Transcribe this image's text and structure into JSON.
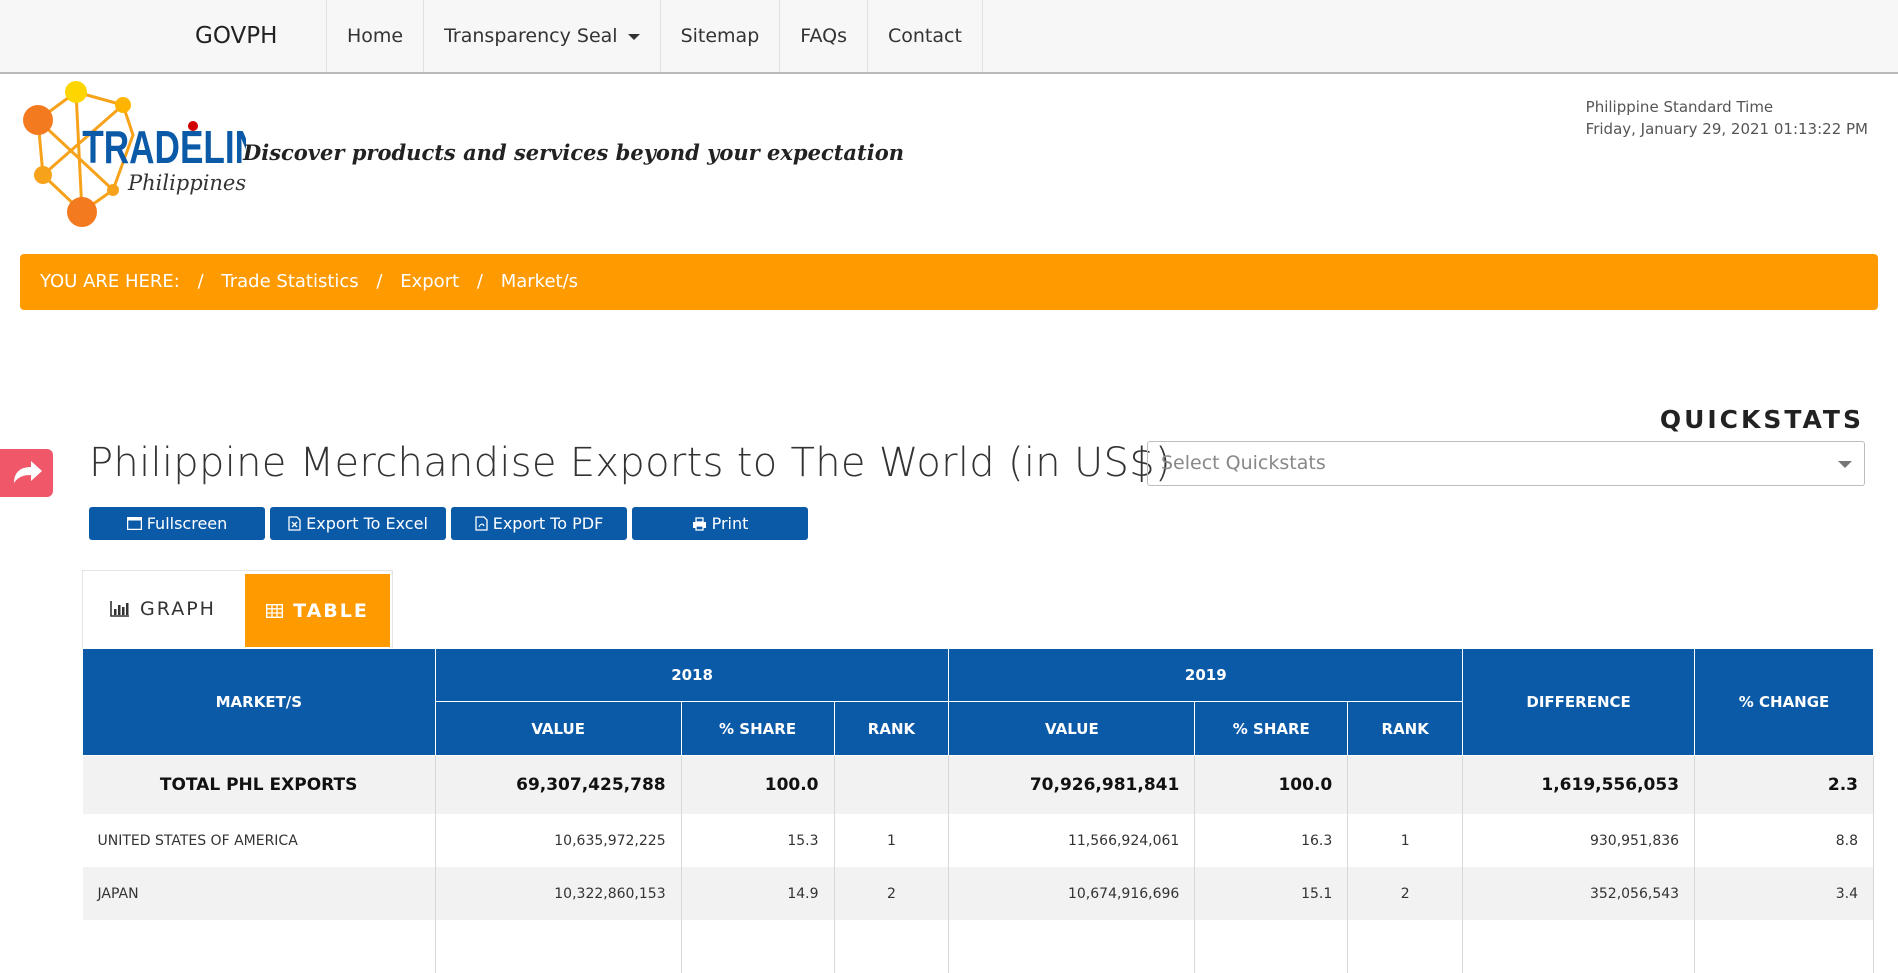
{
  "nav": {
    "brand": "GOVPH",
    "links": [
      "Home",
      "Transparency Seal",
      "Sitemap",
      "FAQs",
      "Contact"
    ]
  },
  "header": {
    "logo_text": "TRADELINE",
    "logo_sub": "Philippines",
    "tagline": "Discover products and services beyond your expectation",
    "clock_label": "Philippine Standard Time",
    "clock_value": "Friday, January 29, 2021 01:13:22 PM"
  },
  "breadcrumb": {
    "prefix": "YOU ARE HERE:",
    "items": [
      "Trade Statistics",
      "Export",
      "Market/s"
    ]
  },
  "page": {
    "title": "Philippine Merchandise Exports to The World (in US$)"
  },
  "quickstats": {
    "label": "QUICKSTATS",
    "placeholder": "Select Quickstats"
  },
  "actions": {
    "fullscreen": "Fullscreen",
    "excel": "Export To Excel",
    "pdf": "Export To PDF",
    "print": "Print"
  },
  "tabs": {
    "graph": "GRAPH",
    "table": "TABLE"
  },
  "table": {
    "headers": {
      "market": "MARKET/S",
      "year1": "2018",
      "year2": "2019",
      "difference": "DIFFERENCE",
      "change": "% CHANGE",
      "value": "VALUE",
      "share": "% SHARE",
      "rank": "RANK"
    },
    "total": {
      "name": "TOTAL PHL EXPORTS",
      "v2018": "69,307,425,788",
      "s2018": "100.0",
      "r2018": "",
      "v2019": "70,926,981,841",
      "s2019": "100.0",
      "r2019": "",
      "diff": "1,619,556,053",
      "chg": "2.3"
    },
    "rows": [
      {
        "name": "UNITED STATES OF AMERICA",
        "v2018": "10,635,972,225",
        "s2018": "15.3",
        "r2018": "1",
        "v2019": "11,566,924,061",
        "s2019": "16.3",
        "r2019": "1",
        "diff": "930,951,836",
        "chg": "8.8"
      },
      {
        "name": "JAPAN",
        "v2018": "10,322,860,153",
        "s2018": "14.9",
        "r2018": "2",
        "v2019": "10,674,916,696",
        "s2019": "15.1",
        "r2019": "2",
        "diff": "352,056,543",
        "chg": "3.4"
      }
    ]
  },
  "colors": {
    "accent_orange": "#ff9a00",
    "primary_blue": "#0a5aa8",
    "share_red": "#f0586a"
  }
}
